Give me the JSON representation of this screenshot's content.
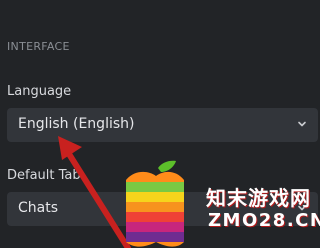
{
  "settings": {
    "section_header": "INTERFACE",
    "language": {
      "label": "Language",
      "value": "English (English)",
      "icon": "chevron-down-icon"
    },
    "default_tab": {
      "label": "Default Tab",
      "value": "Chats",
      "icon": "chevron-down-icon"
    }
  },
  "watermark": {
    "text_cn": "知末游戏网",
    "url": "ZMO28.CN",
    "icon": "apple-logo-icon"
  },
  "annotation": {
    "icon": "red-arrow-icon",
    "color": "#c8211f"
  }
}
